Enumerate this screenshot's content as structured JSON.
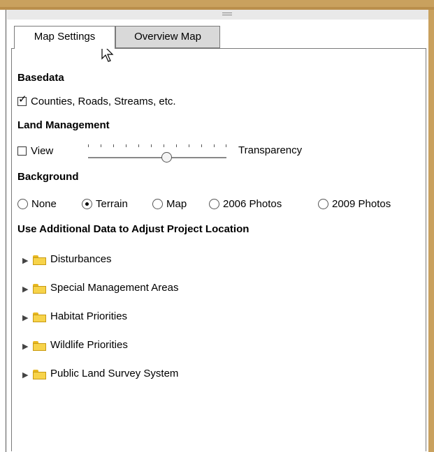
{
  "tabs": [
    {
      "label": "Map Settings",
      "active": true
    },
    {
      "label": "Overview Map",
      "active": false
    }
  ],
  "basedata": {
    "heading": "Basedata",
    "checkbox_label": "Counties, Roads, Streams, etc.",
    "checked": true
  },
  "land_management": {
    "heading": "Land Management",
    "view_label": "View",
    "view_checked": false,
    "transparency_label": "Transparency",
    "transparency_level": 0.58
  },
  "background": {
    "heading": "Background",
    "options": [
      "None",
      "Terrain",
      "Map",
      "2006 Photos",
      "2009 Photos"
    ],
    "selected": "Terrain"
  },
  "additional": {
    "heading": "Use Additional Data to Adjust Project Location",
    "items": [
      "Disturbances",
      "Special Management Areas",
      "Habitat Priorities",
      "Wildlife Priorities",
      "Public Land Survey System"
    ]
  },
  "colors": {
    "accent": "#c9a15e",
    "folder": "#f7d34a"
  },
  "icons": {
    "tree_expand": "right-triangle-icon",
    "folder": "folder-icon"
  }
}
